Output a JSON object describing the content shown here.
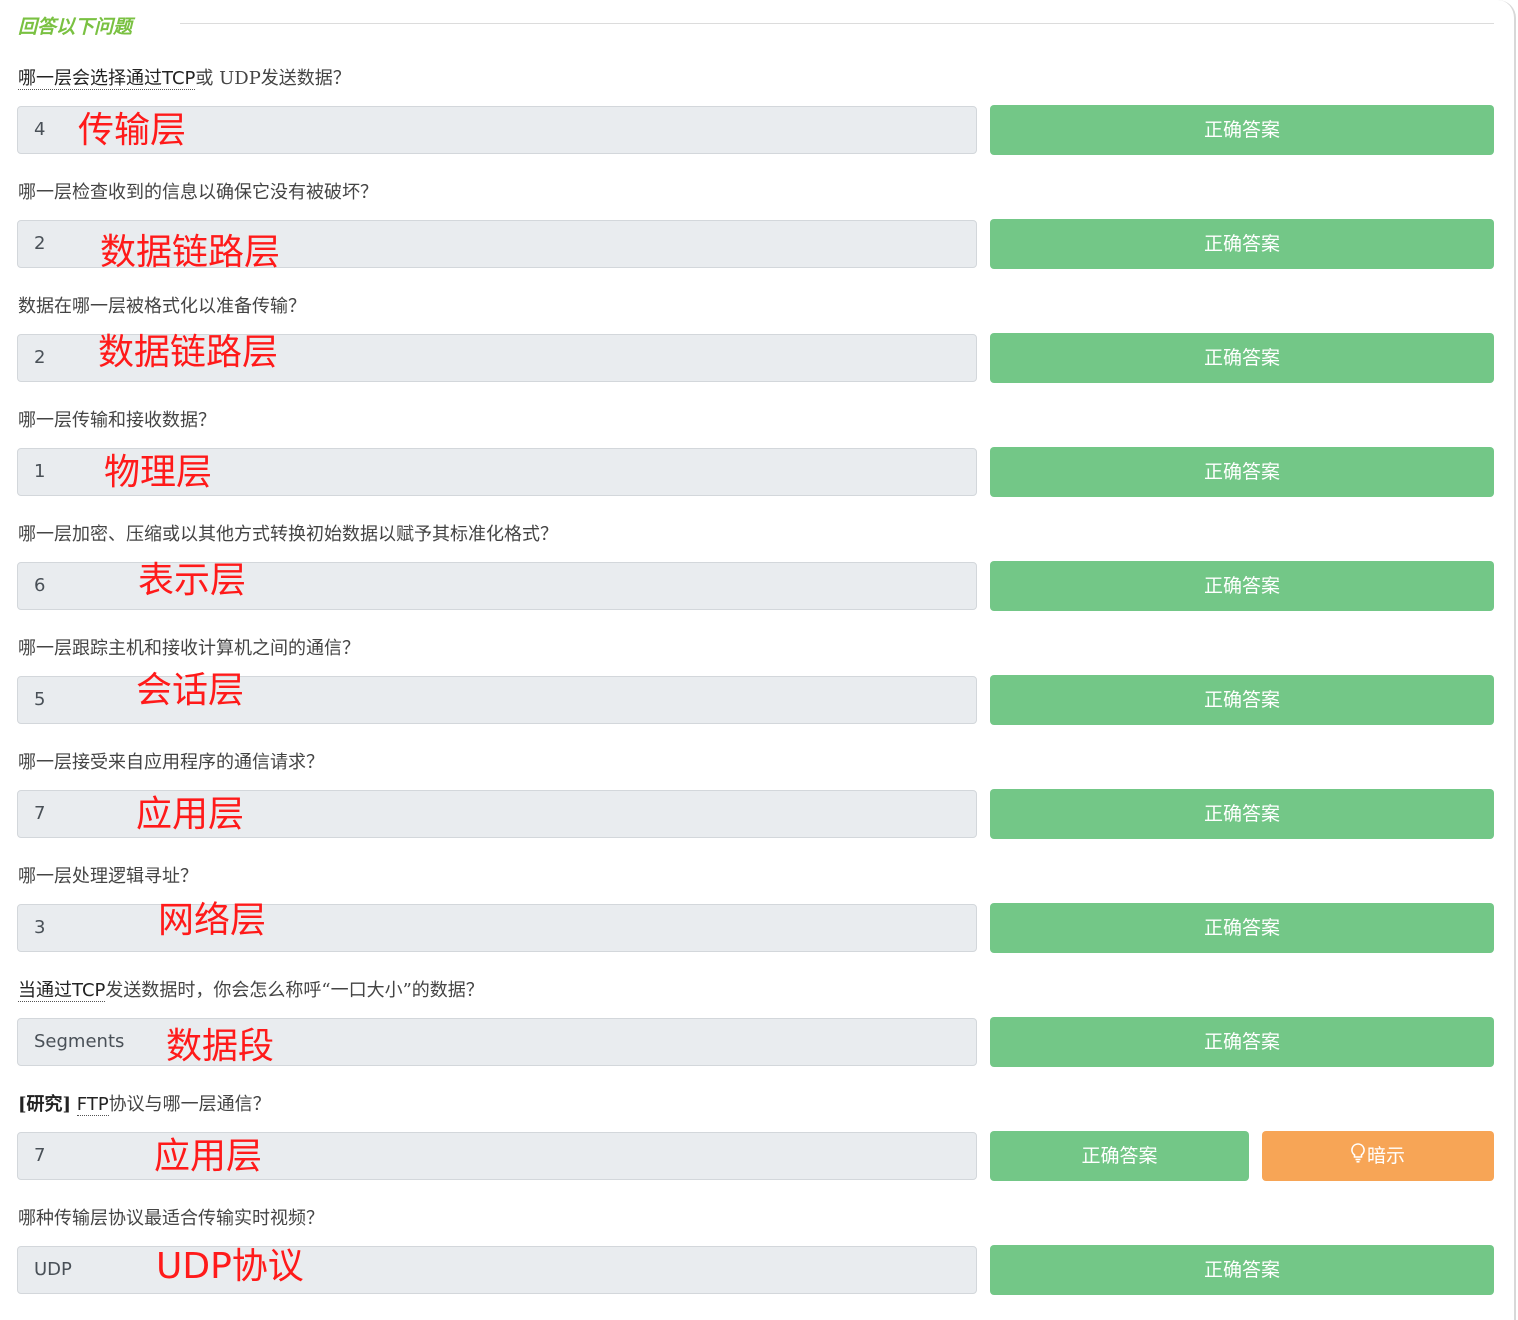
{
  "section": {
    "title": "回答以下问题"
  },
  "hint_label": "暗示",
  "questions": [
    {
      "text": "哪一层会选择通过TCP或 UDP发送数据？",
      "value": "4",
      "note": "传输层",
      "button": "正确答案"
    },
    {
      "text": "哪一层检查收到的信息以确保它没有被破坏？",
      "value": "2",
      "note": "数据链路层",
      "button": "正确答案"
    },
    {
      "text": "数据在哪一层被格式化以准备传输？",
      "value": "2",
      "note": "数据链路层",
      "button": "正确答案"
    },
    {
      "text": "哪一层传输和接收数据？",
      "value": "1",
      "note": "物理层",
      "button": "正确答案"
    },
    {
      "text": "哪一层加密、压缩或以其他方式转换初始数据以赋予其标准化格式？",
      "value": "6",
      "note": "表示层",
      "button": "正确答案"
    },
    {
      "text": "哪一层跟踪主机和接收计算机之间的通信？",
      "value": "5",
      "note": "会话层",
      "button": "正确答案"
    },
    {
      "text": "哪一层接受来自应用程序的通信请求？",
      "value": "7",
      "note": "应用层",
      "button": "正确答案"
    },
    {
      "text": "哪一层处理逻辑寻址？",
      "value": "3",
      "note": "网络层",
      "button": "正确答案"
    },
    {
      "text": "当通过TCP发送数据时，你会怎么称呼“一口大小”的数据？",
      "value": "Segments",
      "note": "数据段",
      "button": "正确答案"
    },
    {
      "text": "[研究] FTP协议与哪一层通信？",
      "value": "7",
      "note": "应用层",
      "button": "正确答案"
    },
    {
      "text": "哪种传输层协议最适合传输实时视频？",
      "value": "UDP",
      "note": "UDP协议",
      "button": "正确答案"
    }
  ]
}
